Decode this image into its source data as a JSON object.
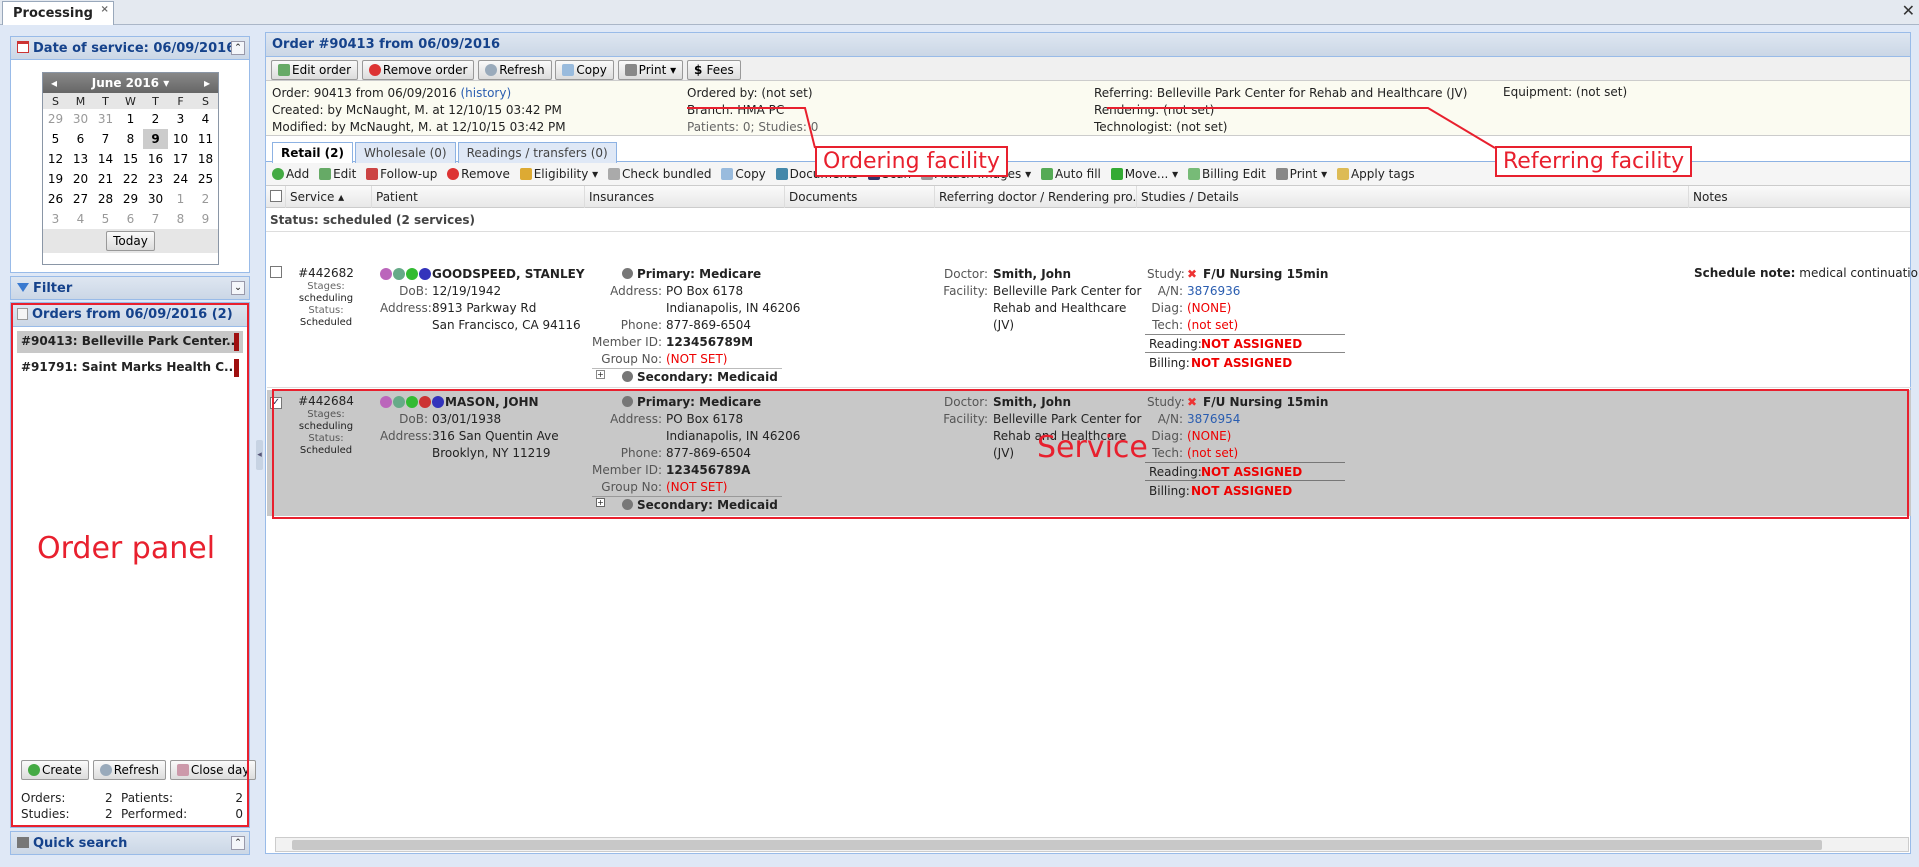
{
  "tab": {
    "label": "Processing",
    "close": "×"
  },
  "window_close": "✕",
  "date_panel": {
    "title": "Date of service: 06/09/2016"
  },
  "calendar": {
    "month": "June 2016 ▾",
    "prev": "◂",
    "next": "▸",
    "days": [
      "S",
      "M",
      "T",
      "W",
      "T",
      "F",
      "S"
    ],
    "weeks": [
      [
        "29",
        "30",
        "31",
        "1",
        "2",
        "3",
        "4"
      ],
      [
        "5",
        "6",
        "7",
        "8",
        "9",
        "10",
        "11"
      ],
      [
        "12",
        "13",
        "14",
        "15",
        "16",
        "17",
        "18"
      ],
      [
        "19",
        "20",
        "21",
        "22",
        "23",
        "24",
        "25"
      ],
      [
        "26",
        "27",
        "28",
        "29",
        "30",
        "1",
        "2"
      ],
      [
        "3",
        "4",
        "5",
        "6",
        "7",
        "8",
        "9"
      ]
    ],
    "today": "Today"
  },
  "filter": {
    "title": "Filter"
  },
  "orders_panel": {
    "title": "Orders from 06/09/2016 (2)",
    "items": [
      {
        "label": "#90413: Belleville Park Center..."
      },
      {
        "label": "#91791: Saint Marks Health C..."
      }
    ],
    "buttons": {
      "create": "Create",
      "refresh": "Refresh",
      "close_day": "Close day"
    },
    "stats": {
      "orders_label": "Orders:",
      "orders": "2",
      "patients_label": "Patients:",
      "patients": "2",
      "studies_label": "Studies:",
      "studies": "2",
      "performed_label": "Performed:",
      "performed": "0"
    },
    "annotation": "Order panel"
  },
  "quick_search": {
    "title": "Quick search"
  },
  "order": {
    "title": "Order #90413 from 06/09/2016",
    "toolbar": {
      "edit": "Edit order",
      "remove": "Remove order",
      "refresh": "Refresh",
      "copy": "Copy",
      "print": "Print ▾",
      "fees": "Fees"
    },
    "info": {
      "order_label": "Order:",
      "order_value": "90413 from 06/09/2016",
      "history": "(history)",
      "created_label": "Created:",
      "created_value": "by McNaught, M. at 12/10/15 03:42 PM",
      "modified_label": "Modified:",
      "modified_value": "by McNaught, M. at 12/10/15 03:42 PM",
      "ordered_by_label": "Ordered by:",
      "ordered_by_value": "(not set)",
      "branch_label": "Branch:",
      "branch_value": "HMA PC",
      "patients_label": "Patients: 0; Studies: 0",
      "referring_label": "Referring:",
      "referring_value": "Belleville Park Center for Rehab and Healthcare (JV)",
      "rendering_label": "Rendering:",
      "rendering_value": "(not set)",
      "technologist_label": "Technologist:",
      "technologist_value": "(not set)",
      "equipment_label": "Equipment:",
      "equipment_value": "(not set)"
    },
    "annot_ordering": "Ordering facility",
    "annot_referring": "Referring facility"
  },
  "subtabs": [
    {
      "label": "Retail (2)"
    },
    {
      "label": "Wholesale (0)"
    },
    {
      "label": "Readings / transfers (0)"
    }
  ],
  "actions": [
    "Add",
    "Edit",
    "Follow-up",
    "Remove",
    "Eligibility ▾",
    "Check bundled",
    "Copy",
    "Documents",
    "Scan",
    "Attach images ▾",
    "Auto fill",
    "Move... ▾",
    "Billing Edit",
    "Print ▾",
    "Apply tags"
  ],
  "columns": {
    "service": "Service ▴",
    "patient": "Patient",
    "insurances": "Insurances",
    "documents": "Documents",
    "referring": "Referring doctor / Rendering pro...",
    "studies": "Studies / Details",
    "notes": "Notes"
  },
  "status_group": "Status: scheduled (2 services)",
  "rows": [
    {
      "id": "#442682",
      "stages_label": "Stages:",
      "stages": "scheduling",
      "status_label": "Status:",
      "status": "Scheduled",
      "checked": "",
      "name": "GOODSPEED, STANLEY",
      "dob_label": "DoB:",
      "dob": "12/19/1942",
      "address_label": "Address:",
      "address1": "8913 Parkway Rd",
      "address2": "San Francisco, CA 94116",
      "primary": "Primary: Medicare",
      "ins_address_label": "Address:",
      "ins_address1": "PO Box 6178",
      "ins_address2": "Indianapolis, IN 46206",
      "phone_label": "Phone:",
      "phone": "877-869-6504",
      "member_label": "Member ID:",
      "member": "123456789M",
      "group_label": "Group No:",
      "group": "(NOT SET)",
      "secondary": "Secondary: Medicaid",
      "doctor_label": "Doctor:",
      "doctor": "Smith, John",
      "facility_label": "Facility:",
      "facility1": "Belleville Park Center for",
      "facility2": "Rehab and Healthcare",
      "facility3": "(JV)",
      "study_label": "Study:",
      "study": "F/U Nursing 15min",
      "an_label": "A/N:",
      "an": "3876936",
      "diag_label": "Diag:",
      "diag": "(NONE)",
      "tech_label": "Tech:",
      "tech": "(not set)",
      "reading_label": "Reading:",
      "reading": "NOT ASSIGNED",
      "billing_label": "Billing:",
      "billing": "NOT ASSIGNED",
      "note_label": "Schedule note:",
      "note": "medical continuation"
    },
    {
      "id": "#442684",
      "stages_label": "Stages:",
      "stages": "scheduling",
      "status_label": "Status:",
      "status": "Scheduled",
      "checked": "✓",
      "name": "MASON, JOHN",
      "dob_label": "DoB:",
      "dob": "03/01/1938",
      "address_label": "Address:",
      "address1": "316 San Quentin Ave",
      "address2": "Brooklyn, NY 11219",
      "primary": "Primary: Medicare",
      "ins_address_label": "Address:",
      "ins_address1": "PO Box 6178",
      "ins_address2": "Indianapolis, IN 46206",
      "phone_label": "Phone:",
      "phone": "877-869-6504",
      "member_label": "Member ID:",
      "member": "123456789A",
      "group_label": "Group No:",
      "group": "(NOT SET)",
      "secondary": "Secondary: Medicaid",
      "doctor_label": "Doctor:",
      "doctor": "Smith, John",
      "facility_label": "Facility:",
      "facility1": "Belleville Park Center for",
      "facility2": "Rehab and Healthcare",
      "facility3": "(JV)",
      "study_label": "Study:",
      "study": "F/U Nursing 15min",
      "an_label": "A/N:",
      "an": "3876954",
      "diag_label": "Diag:",
      "diag": "(NONE)",
      "tech_label": "Tech:",
      "tech": "(not set)",
      "reading_label": "Reading:",
      "reading": "NOT ASSIGNED",
      "billing_label": "Billing:",
      "billing": "NOT ASSIGNED",
      "annotation": "Service"
    }
  ],
  "colors": {
    "annotation": "#e8202e",
    "selected_row": "#c8c8c8",
    "panel_bg": "#dfe8f6"
  }
}
